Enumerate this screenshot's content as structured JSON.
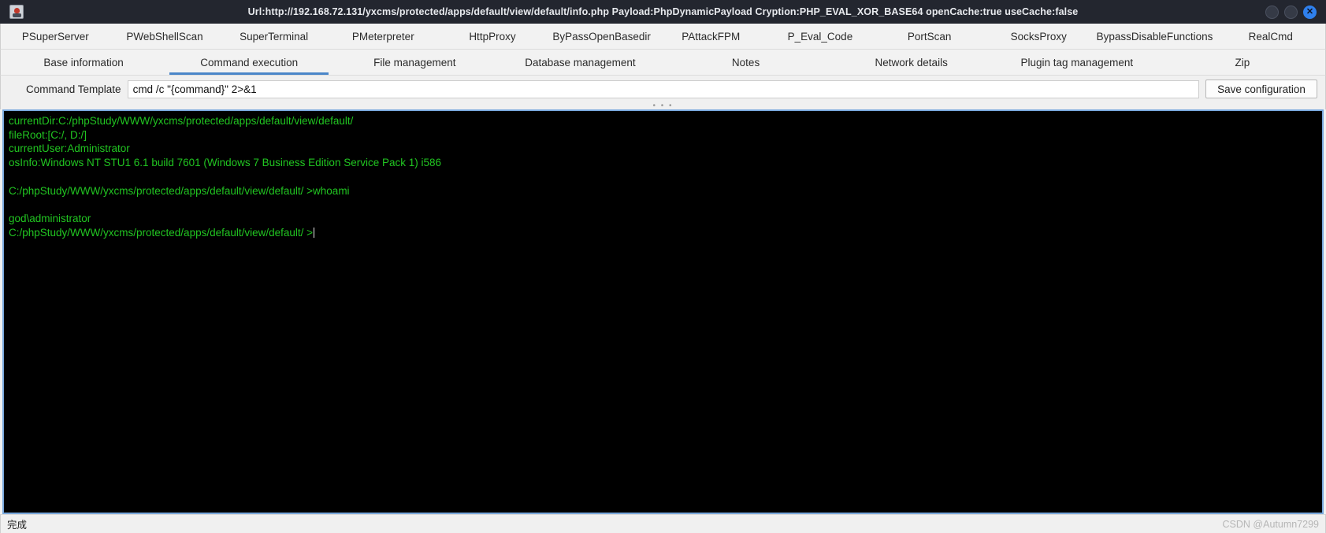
{
  "titlebar": {
    "title": "Url:http://192.168.72.131/yxcms/protected/apps/default/view/default/info.php Payload:PhpDynamicPayload Cryption:PHP_EVAL_XOR_BASE64 openCache:true useCache:false",
    "logo_icon": "app-logo-icon",
    "minimize_icon": "minimize-icon",
    "maximize_icon": "maximize-icon",
    "close_icon": "close-icon",
    "close_glyph": "✕",
    "background_color": "#23262f",
    "close_button_color": "#2f80ed"
  },
  "top_tabs": [
    {
      "label": "PSuperServer",
      "active": false
    },
    {
      "label": "PWebShellScan",
      "active": false
    },
    {
      "label": "SuperTerminal",
      "active": false
    },
    {
      "label": "PMeterpreter",
      "active": false
    },
    {
      "label": "HttpProxy",
      "active": false
    },
    {
      "label": "ByPassOpenBasedir",
      "active": false
    },
    {
      "label": "PAttackFPM",
      "active": false
    },
    {
      "label": "P_Eval_Code",
      "active": false
    },
    {
      "label": "PortScan",
      "active": false
    },
    {
      "label": "SocksProxy",
      "active": false
    },
    {
      "label": "BypassDisableFunctions",
      "active": false
    },
    {
      "label": "RealCmd",
      "active": false
    }
  ],
  "sub_tabs": [
    {
      "label": "Base information",
      "active": false
    },
    {
      "label": "Command execution",
      "active": true
    },
    {
      "label": "File management",
      "active": false
    },
    {
      "label": "Database management",
      "active": false
    },
    {
      "label": "Notes",
      "active": false
    },
    {
      "label": "Network details",
      "active": false
    },
    {
      "label": "Plugin tag management",
      "active": false
    },
    {
      "label": "Zip",
      "active": false
    }
  ],
  "active_tab_underline_color": "#4a86c8",
  "toolbar": {
    "template_label": "Command Template",
    "template_value": "cmd /c \"{command}\" 2>&1",
    "template_placeholder": "",
    "save_label": "Save configuration"
  },
  "splitter": {
    "handle_glyph": "• • •"
  },
  "terminal": {
    "text_color": "#21c521",
    "background_color": "#000000",
    "border_color": "#7aa9dd",
    "lines": [
      "currentDir:C:/phpStudy/WWW/yxcms/protected/apps/default/view/default/",
      "fileRoot:[C:/, D:/]",
      "currentUser:Administrator",
      "osInfo:Windows NT STU1 6.1 build 7601 (Windows 7 Business Edition Service Pack 1) i586",
      "",
      "C:/phpStudy/WWW/yxcms/protected/apps/default/view/default/ >whoami",
      "",
      "god\\administrator"
    ],
    "prompt_line": "C:/phpStudy/WWW/yxcms/protected/apps/default/view/default/ >"
  },
  "statusbar": {
    "status": "完成",
    "watermark": "CSDN @Autumn7299"
  }
}
